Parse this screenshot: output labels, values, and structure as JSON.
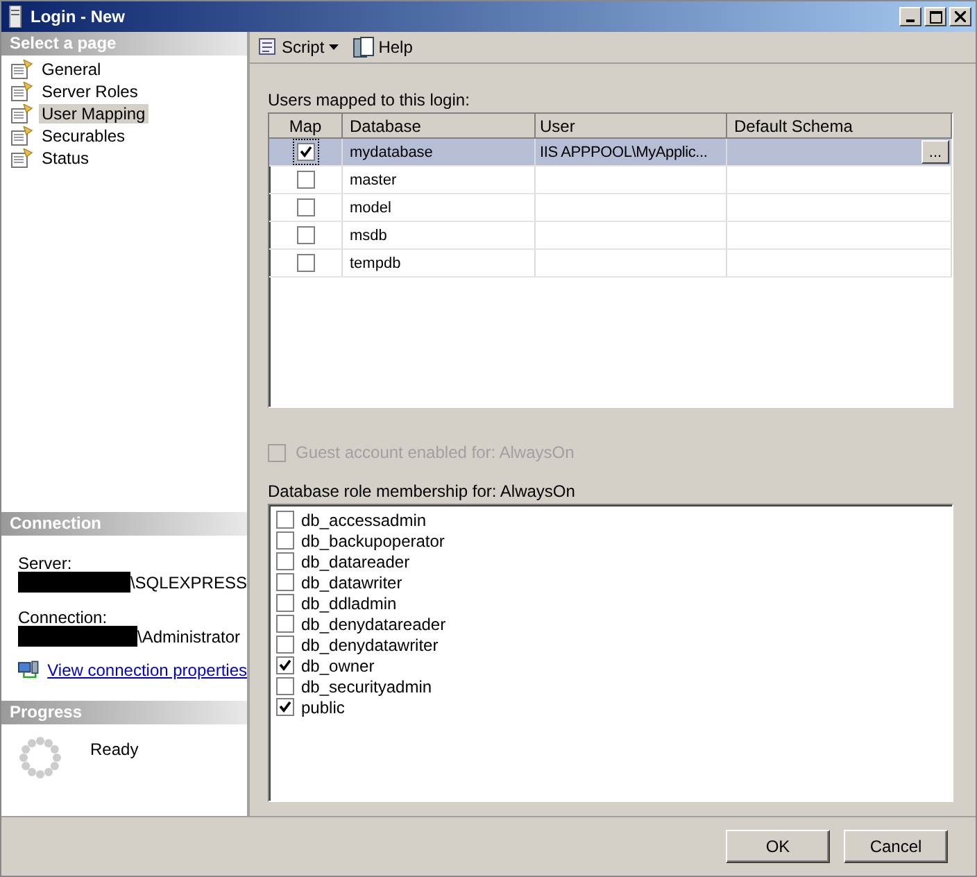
{
  "window": {
    "title": "Login - New"
  },
  "sidebar": {
    "header": "Select a page",
    "items": [
      {
        "label": "General",
        "selected": false
      },
      {
        "label": "Server Roles",
        "selected": false
      },
      {
        "label": "User Mapping",
        "selected": true
      },
      {
        "label": "Securables",
        "selected": false
      },
      {
        "label": "Status",
        "selected": false
      }
    ]
  },
  "connection": {
    "header": "Connection",
    "server_label": "Server:",
    "server_value": "\\SQLEXPRESS",
    "connection_label": "Connection:",
    "connection_value": "\\Administrator",
    "link": "View connection properties"
  },
  "progress": {
    "header": "Progress",
    "status": "Ready"
  },
  "toolbar": [
    {
      "label": "Script",
      "kind": "dropdown"
    },
    {
      "label": "Help",
      "kind": "plain"
    }
  ],
  "mapping": {
    "label": "Users mapped to this login:",
    "columns": [
      "Map",
      "Database",
      "User",
      "Default Schema"
    ],
    "rows": [
      {
        "checked": true,
        "selected": true,
        "database": "mydatabase",
        "user": "IIS APPPOOL\\MyApplic...",
        "schema_button": "..."
      },
      {
        "checked": false,
        "selected": false,
        "database": "master"
      },
      {
        "checked": false,
        "selected": false,
        "database": "model"
      },
      {
        "checked": false,
        "selected": false,
        "database": "msdb"
      },
      {
        "checked": false,
        "selected": false,
        "database": "tempdb"
      }
    ]
  },
  "guest": {
    "label": "Guest account enabled for: AlwaysOn",
    "checked": false,
    "disabled": true
  },
  "roles": {
    "label": "Database role membership for: AlwaysOn",
    "items": [
      {
        "name": "db_accessadmin",
        "checked": false
      },
      {
        "name": "db_backupoperator",
        "checked": false
      },
      {
        "name": "db_datareader",
        "checked": false
      },
      {
        "name": "db_datawriter",
        "checked": false
      },
      {
        "name": "db_ddladmin",
        "checked": false
      },
      {
        "name": "db_denydatareader",
        "checked": false
      },
      {
        "name": "db_denydatawriter",
        "checked": false
      },
      {
        "name": "db_owner",
        "checked": true
      },
      {
        "name": "db_securityadmin",
        "checked": false
      },
      {
        "name": "public",
        "checked": true
      }
    ]
  },
  "buttons": [
    "OK",
    "Cancel"
  ]
}
